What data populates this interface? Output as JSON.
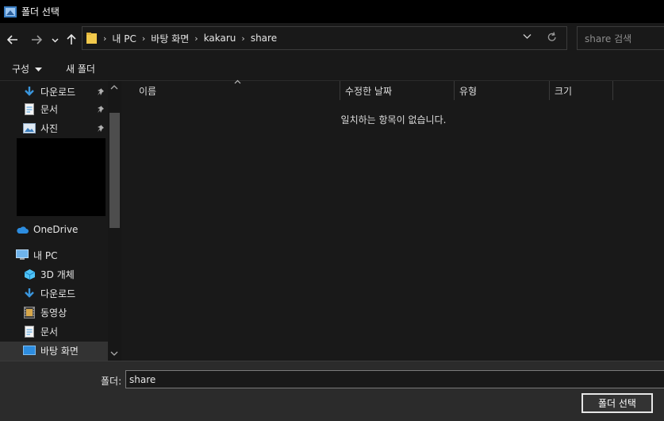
{
  "window": {
    "title": "폴더 선택"
  },
  "nav": {
    "breadcrumbs": [
      "내 PC",
      "바탕 화면",
      "kakaru",
      "share"
    ],
    "search_placeholder": "share 검색"
  },
  "commands": {
    "organize": "구성",
    "new_folder": "새 폴더"
  },
  "sidebar": {
    "quick_access": [
      {
        "label": "다운로드",
        "icon": "download-arrow-icon",
        "pinned": true
      },
      {
        "label": "문서",
        "icon": "document-icon",
        "pinned": true
      },
      {
        "label": "사진",
        "icon": "pictures-icon",
        "pinned": true
      }
    ],
    "onedrive": {
      "label": "OneDrive",
      "icon": "cloud-icon"
    },
    "this_pc": {
      "label": "내 PC",
      "icon": "computer-icon"
    },
    "pc_items": [
      {
        "label": "3D 개체",
        "icon": "cube-3d-icon"
      },
      {
        "label": "다운로드",
        "icon": "download-arrow-icon"
      },
      {
        "label": "동영상",
        "icon": "video-icon"
      },
      {
        "label": "문서",
        "icon": "document-icon"
      },
      {
        "label": "바탕 화면",
        "icon": "desktop-icon",
        "selected": true
      }
    ]
  },
  "columns": [
    "이름",
    "수정한 날짜",
    "유형",
    "크기"
  ],
  "empty_message": "일치하는 항목이 없습니다.",
  "footer": {
    "folder_label": "폴더:",
    "folder_value": "share",
    "select_button": "폴더 선택"
  },
  "colors": {
    "accent": "#1e90ff",
    "folder": "#f2c94c",
    "selected": "#333333"
  }
}
